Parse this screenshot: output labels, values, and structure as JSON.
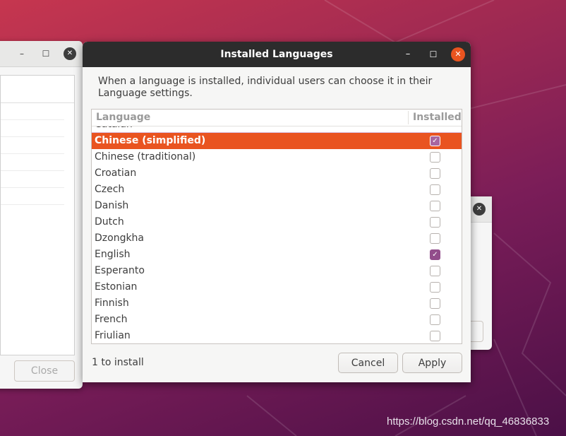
{
  "dialog": {
    "title": "Installed Languages",
    "controls": {
      "minimize": "–",
      "maximize": "☐",
      "close": "✕"
    },
    "description": "When a language is installed, individual users can choose it in their Language settings.",
    "columns": {
      "language": "Language",
      "installed": "Installed"
    },
    "partial_row": {
      "label": "Catalan",
      "installed": false
    },
    "languages": [
      {
        "label": "Chinese (simplified)",
        "installed": true,
        "selected": true
      },
      {
        "label": "Chinese (traditional)",
        "installed": false
      },
      {
        "label": "Croatian",
        "installed": false
      },
      {
        "label": "Czech",
        "installed": false
      },
      {
        "label": "Danish",
        "installed": false
      },
      {
        "label": "Dutch",
        "installed": false
      },
      {
        "label": "Dzongkha",
        "installed": false
      },
      {
        "label": "English",
        "installed": true
      },
      {
        "label": "Esperanto",
        "installed": false
      },
      {
        "label": "Estonian",
        "installed": false
      },
      {
        "label": "Finnish",
        "installed": false
      },
      {
        "label": "French",
        "installed": false
      },
      {
        "label": "Friulian",
        "installed": false
      }
    ],
    "status": "1 to install",
    "cancel_label": "Cancel",
    "apply_label": "Apply"
  },
  "background_window": {
    "close_label": "Close",
    "controls": {
      "minimize": "–",
      "maximize": "☐",
      "close": "✕"
    }
  },
  "background_window_right": {
    "close": "✕"
  },
  "watermark": "https://blog.csdn.net/qq_46836833",
  "colors": {
    "accent": "#e95420",
    "checkbox": "#924d8b",
    "titlebar": "#2c2c2c"
  }
}
